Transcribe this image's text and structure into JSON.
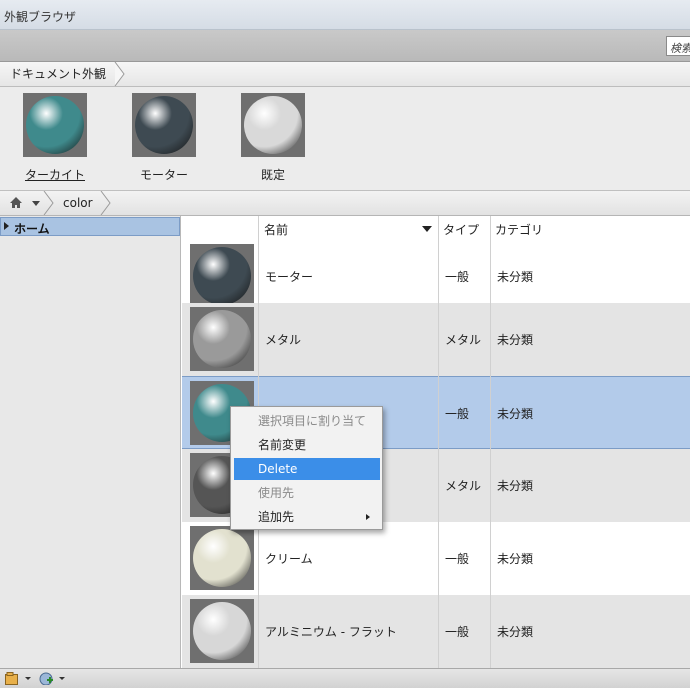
{
  "window": {
    "title": "外観ブラウザ"
  },
  "search": {
    "placeholder": "検索"
  },
  "document_breadcrumb": {
    "label": "ドキュメント外観"
  },
  "document_appearances": [
    {
      "label": "ターカイト",
      "color": "#3f8a8c"
    },
    {
      "label": "モーター",
      "color": "#3e4a52"
    },
    {
      "label": "既定",
      "color": "#d9d9d9"
    }
  ],
  "library_breadcrumb": {
    "home_icon": "home-icon",
    "path": "color"
  },
  "sidebar": {
    "items": [
      {
        "label": "ホーム"
      }
    ]
  },
  "table": {
    "columns": {
      "name": "名前",
      "type": "タイプ",
      "category": "カテゴリ"
    },
    "rows": [
      {
        "name": "モーター",
        "type": "一般",
        "category": "未分類",
        "color": "#3e4a52"
      },
      {
        "name": "メタル",
        "type": "メタル",
        "category": "未分類",
        "color": "#9a9a9a"
      },
      {
        "name": "",
        "type": "一般",
        "category": "未分類",
        "color": "#3f8a8c"
      },
      {
        "name": "",
        "type": "メタル",
        "category": "未分類",
        "color": "#555555"
      },
      {
        "name": "クリーム",
        "type": "一般",
        "category": "未分類",
        "color": "#e2e1cf"
      },
      {
        "name": "アルミニウム - フラット",
        "type": "一般",
        "category": "未分類",
        "color": "#d7d7d7"
      }
    ]
  },
  "context_menu": {
    "items": [
      {
        "label": "選択項目に割り当て",
        "state": "disabled"
      },
      {
        "label": "名前変更",
        "state": "normal"
      },
      {
        "label": "Delete",
        "state": "highlighted"
      },
      {
        "label": "使用先",
        "state": "disabled"
      },
      {
        "label": "追加先",
        "state": "submenu"
      }
    ]
  },
  "footer": {
    "icons": [
      "library-options-icon",
      "add-library-icon"
    ]
  },
  "colors": {
    "selection": "#b3cbea",
    "menu_highlight": "#3b8ee8"
  }
}
